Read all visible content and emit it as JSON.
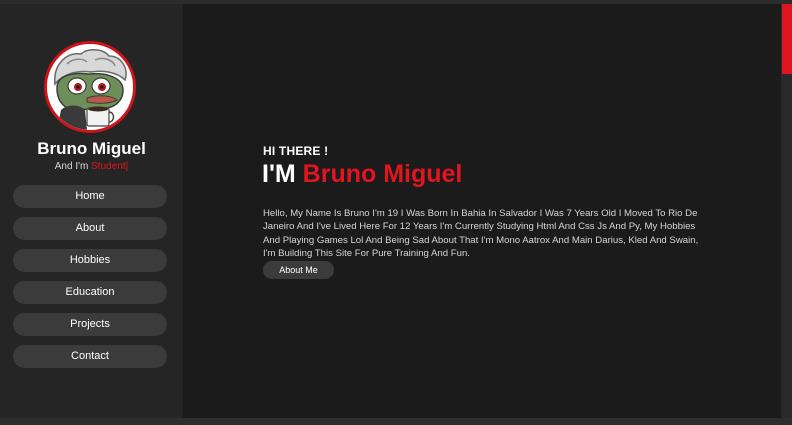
{
  "profile": {
    "name": "Bruno Miguel",
    "subtitle_prefix": "And I'm ",
    "subtitle_role": "Student|",
    "avatar_icon": "pepe-cartoon-avatar"
  },
  "nav": {
    "items": [
      {
        "label": "Home"
      },
      {
        "label": "About"
      },
      {
        "label": "Hobbies"
      },
      {
        "label": "Education"
      },
      {
        "label": "Projects"
      },
      {
        "label": "Contact"
      }
    ]
  },
  "hero": {
    "greeting": "HI THERE !",
    "headline_prefix": "I'M ",
    "headline_name": "Bruno Miguel",
    "bio": "Hello, My Name Is Bruno I'm 19 I Was Born In Bahia In Salvador I Was 7 Years Old I Moved To Rio De Janeiro And I've Lived Here For 12 Years I'm Currently Studying Html And Css Js And Py, My Hobbies And Playing Games Lol And Being Sad About That I'm Mono Aatrox And Main Darius, Kled And Swain, I'm Building This Site For Pure Training And Fun.",
    "button_label": "About Me"
  },
  "colors": {
    "accent": "#e0151f",
    "sidebar_bg": "#252525",
    "main_bg": "#1b1b1b",
    "button_bg": "#3b3b3b"
  }
}
